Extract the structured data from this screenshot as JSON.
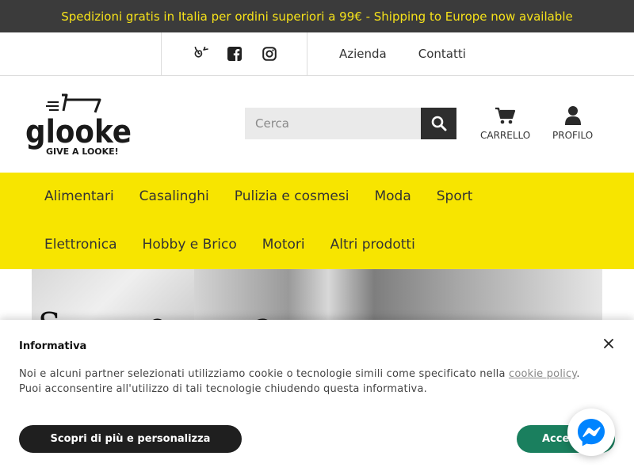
{
  "promo": {
    "text": "Spedizioni gratis in Italia per ordini superiori a 99€ - Shipping to Europe now available"
  },
  "topbar": {
    "social_icons": [
      "spiral-icon",
      "facebook-icon",
      "instagram-icon"
    ],
    "links": [
      "Azienda",
      "Contatti"
    ]
  },
  "header": {
    "logo": {
      "brand": "glooke",
      "tagline": "GIVE A LOOKE!"
    },
    "search": {
      "placeholder": "Cerca",
      "value": ""
    },
    "cart_label": "CARRELLO",
    "profile_label": "PROFILO"
  },
  "nav": {
    "items": [
      "Alimentari",
      "Casalinghi",
      "Pulizia e cosmesi",
      "Moda",
      "Sport",
      "Elettronica",
      "Hobby e Brico",
      "Motori",
      "Altri prodotti"
    ]
  },
  "hero": {
    "partial_text": "S e a"
  },
  "cookie": {
    "title": "Informativa",
    "text_before": "Noi e alcuni partner selezionati utilizziamo cookie o tecnologie simili come specificato nella ",
    "link_text": "cookie policy",
    "text_after": ". Puoi acconsentire all'utilizzo di tali tecnologie chiudendo questa informativa.",
    "more_button": "Scopri di più e personalizza",
    "accept_button": "Accetta"
  },
  "colors": {
    "promo_bg": "#3b3b3b",
    "promo_text": "#f6e21a",
    "nav_bg": "#f7e500",
    "accept_bg": "#1a7f5e",
    "messenger": "#0084ff"
  }
}
